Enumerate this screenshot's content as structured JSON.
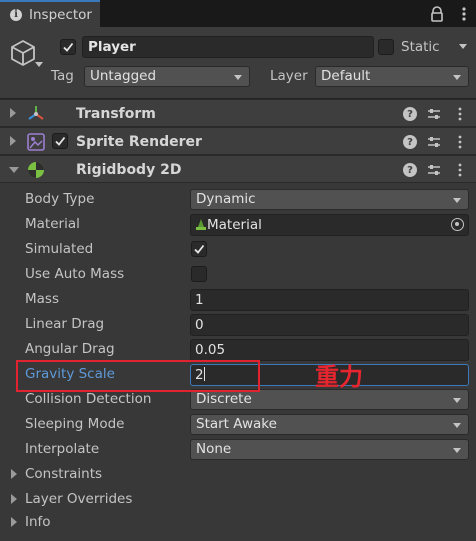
{
  "tab": {
    "title": "Inspector",
    "icon": "info-icon"
  },
  "header": {
    "name": "Player",
    "active": true,
    "static_label": "Static",
    "static_checked": false,
    "tag_label": "Tag",
    "tag_value": "Untagged",
    "layer_label": "Layer",
    "layer_value": "Default"
  },
  "components": [
    {
      "title": "Transform",
      "icon": "transform-icon",
      "expanded": false
    },
    {
      "title": "Sprite Renderer",
      "icon": "sprite-renderer-icon",
      "expanded": false,
      "enabled": true
    },
    {
      "title": "Rigidbody 2D",
      "icon": "rigidbody2d-icon",
      "expanded": true
    }
  ],
  "rigidbody": {
    "body_type": {
      "label": "Body Type",
      "value": "Dynamic"
    },
    "material": {
      "label": "Material",
      "value": "Material"
    },
    "simulated": {
      "label": "Simulated",
      "checked": true
    },
    "use_auto_mass": {
      "label": "Use Auto Mass",
      "checked": false
    },
    "mass": {
      "label": "Mass",
      "value": "1"
    },
    "linear_drag": {
      "label": "Linear Drag",
      "value": "0"
    },
    "angular_drag": {
      "label": "Angular Drag",
      "value": "0.05"
    },
    "gravity_scale": {
      "label": "Gravity Scale",
      "value": "2"
    },
    "collision_detection": {
      "label": "Collision Detection",
      "value": "Discrete"
    },
    "sleeping_mode": {
      "label": "Sleeping Mode",
      "value": "Start Awake"
    },
    "interpolate": {
      "label": "Interpolate",
      "value": "None"
    }
  },
  "foldouts": [
    "Constraints",
    "Layer Overrides",
    "Info"
  ],
  "annotation": {
    "text": "重力",
    "color": "#e0232e"
  },
  "colors": {
    "accent": "#3a79bb",
    "background": "#383838",
    "highlight_label": "#5e9ad9"
  }
}
